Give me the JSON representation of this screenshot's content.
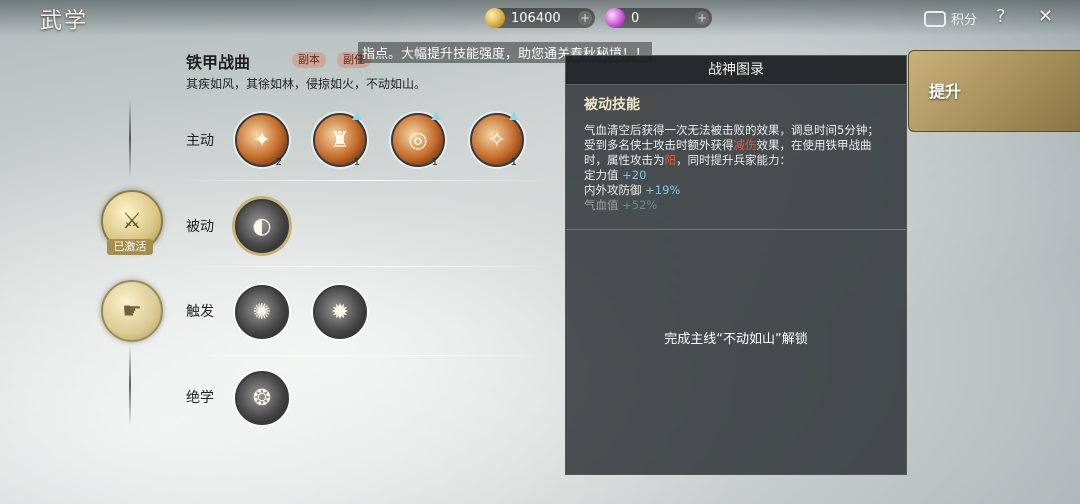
{
  "header": {
    "title": "武学",
    "coins": "106400",
    "gems": "0",
    "score_label": "积分",
    "help_glyph": "?",
    "close_glyph": "✕"
  },
  "skill": {
    "name": "铁甲战曲",
    "tag1": "副本",
    "tag2": "副任",
    "motto": "其疾如风，其徐如林，侵掠如火，不动如山。",
    "notice": "指点。大幅提升技能强度，助您通关春秋秘境！！"
  },
  "rows": {
    "active": "主动",
    "passive": "被动",
    "trigger": "触发",
    "ultimate": "绝学"
  },
  "active_skills": [
    {
      "level": "2",
      "upgradable": false
    },
    {
      "level": "1",
      "upgradable": true
    },
    {
      "level": "1",
      "upgradable": true
    },
    {
      "level": "1",
      "upgradable": true
    }
  ],
  "passive_status": "已激活",
  "codex": {
    "title": "战神图录",
    "subtitle": "被动技能",
    "desc_part1": "气血清空后获得一次无法被击败的效果，调息时间5分钟；受到多名侠士攻击时额外获得",
    "desc_red1": "减伤",
    "desc_part2": "效果，在使用铁甲战曲时，属性攻击为",
    "desc_red2": "阳",
    "desc_part3": "，同时提升兵家能力：",
    "stat1_label": "定力值",
    "stat1_value": "+20",
    "stat2_label": "内外攻防御",
    "stat2_value": "+19%",
    "stat3_label": "气血值",
    "stat3_value": "+52%",
    "unlock_text": "完成主线“不动如山”解锁"
  },
  "promote_label": "提升"
}
